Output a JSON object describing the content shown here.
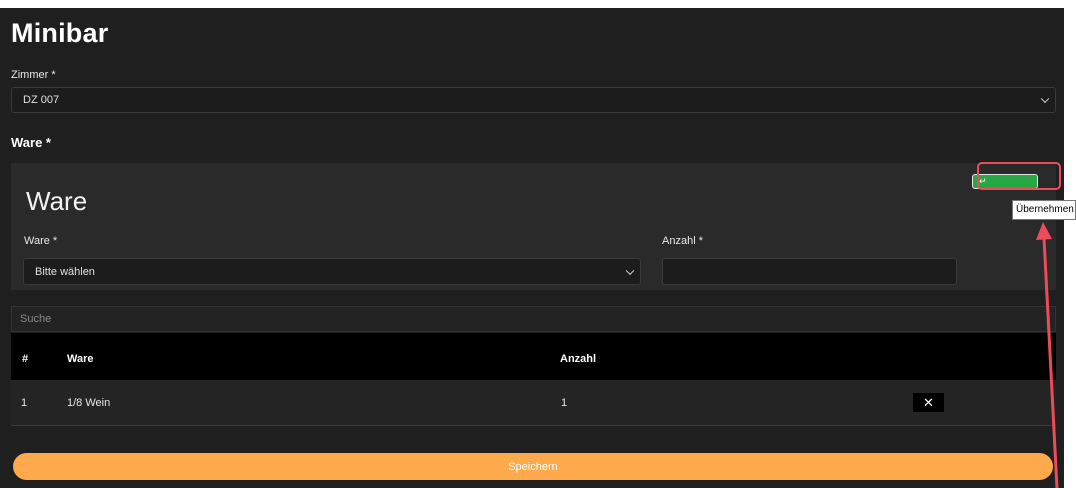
{
  "page": {
    "title": "Minibar"
  },
  "room": {
    "label": "Zimmer *",
    "selected": "DZ 007"
  },
  "ware_section_label": "Ware *",
  "ware_card": {
    "title": "Ware",
    "ware_label": "Ware *",
    "ware_selected": "Bitte wählen",
    "anzahl_label": "Anzahl *",
    "anzahl_value": "",
    "apply_icon": "return-arrow-icon",
    "apply_glyph": "↵",
    "apply_tooltip": "Übernehmen"
  },
  "search": {
    "placeholder": "Suche"
  },
  "table": {
    "headers": [
      "#",
      "Ware",
      "Anzahl"
    ],
    "rows": [
      {
        "num": "1",
        "ware": "1/8 Wein",
        "anzahl": "1",
        "delete_glyph": "✕"
      }
    ]
  },
  "save_label": "Speichern",
  "colors": {
    "background": "#1f1f1f",
    "card": "#2a2a2a",
    "apply_button": "#27a844",
    "save_button": "#fda94c",
    "annotation": "#ee4b5a"
  }
}
